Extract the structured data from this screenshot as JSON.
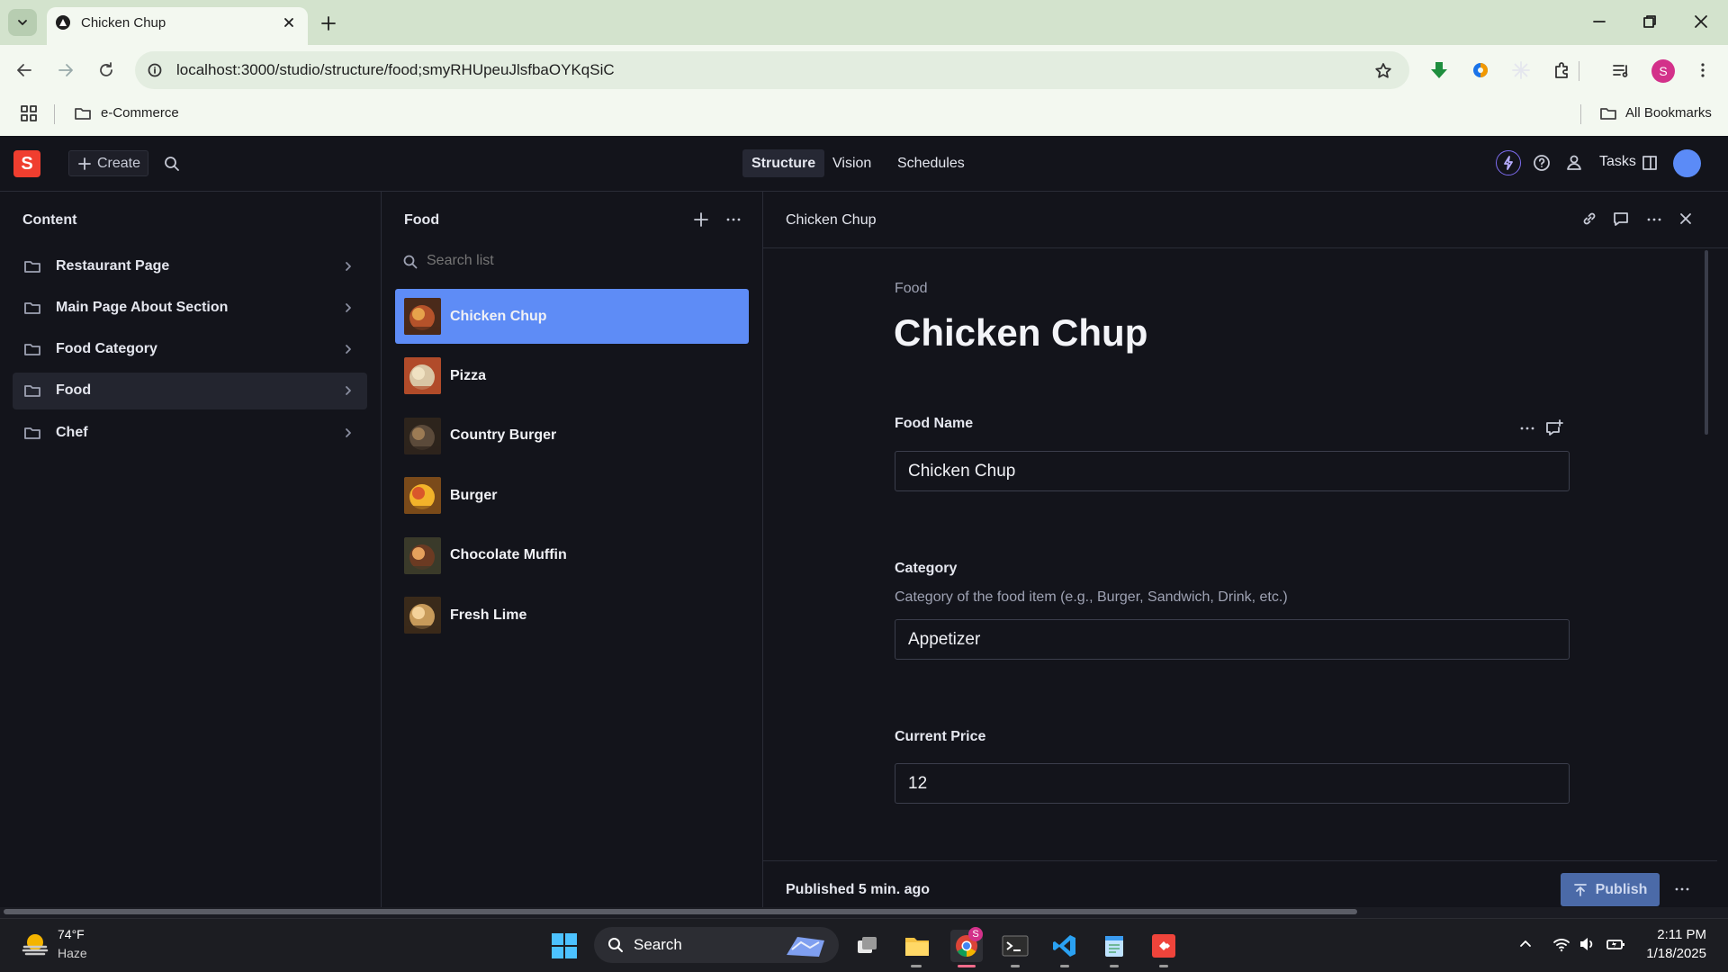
{
  "browser": {
    "tab_title": "Chicken Chup",
    "url": "localhost:3000/studio/structure/food;smyRHUpeuJlsfbaOYKqSiC",
    "bookmark_folder": "e-Commerce",
    "all_bookmarks": "All Bookmarks",
    "profile_initial": "S"
  },
  "studio": {
    "logo_letter": "S",
    "create_label": "Create",
    "nav_tabs": [
      "Structure",
      "Vision",
      "Schedules"
    ],
    "tasks_label": "Tasks"
  },
  "content_pane": {
    "title": "Content",
    "items": [
      {
        "label": "Restaurant Page",
        "selected": false
      },
      {
        "label": "Main Page About Section",
        "selected": false
      },
      {
        "label": "Food Category",
        "selected": false
      },
      {
        "label": "Food",
        "selected": true
      },
      {
        "label": "Chef",
        "selected": false
      }
    ]
  },
  "food_pane": {
    "title": "Food",
    "search_placeholder": "Search list",
    "items": [
      {
        "name": "Chicken Chup",
        "selected": true
      },
      {
        "name": "Pizza",
        "selected": false
      },
      {
        "name": "Country Burger",
        "selected": false
      },
      {
        "name": "Burger",
        "selected": false
      },
      {
        "name": "Chocolate Muffin",
        "selected": false
      },
      {
        "name": "Fresh Lime",
        "selected": false
      }
    ]
  },
  "document": {
    "pane_title": "Chicken Chup",
    "type_label": "Food",
    "title": "Chicken Chup",
    "fields": {
      "food_name": {
        "label": "Food Name",
        "value": "Chicken Chup"
      },
      "category": {
        "label": "Category",
        "description": "Category of the food item (e.g., Burger, Sandwich, Drink, etc.)",
        "value": "Appetizer"
      },
      "current_price": {
        "label": "Current Price",
        "value": "12"
      }
    },
    "status": "Published 5 min. ago",
    "publish_label": "Publish"
  },
  "taskbar": {
    "temperature": "74°F",
    "condition": "Haze",
    "search_label": "Search",
    "chrome_badge": "S",
    "time": "2:11 PM",
    "date": "1/18/2025"
  },
  "colors": {
    "accent": "#5e8cf6",
    "brand_red": "#f03e2f",
    "background": "#13141b"
  }
}
